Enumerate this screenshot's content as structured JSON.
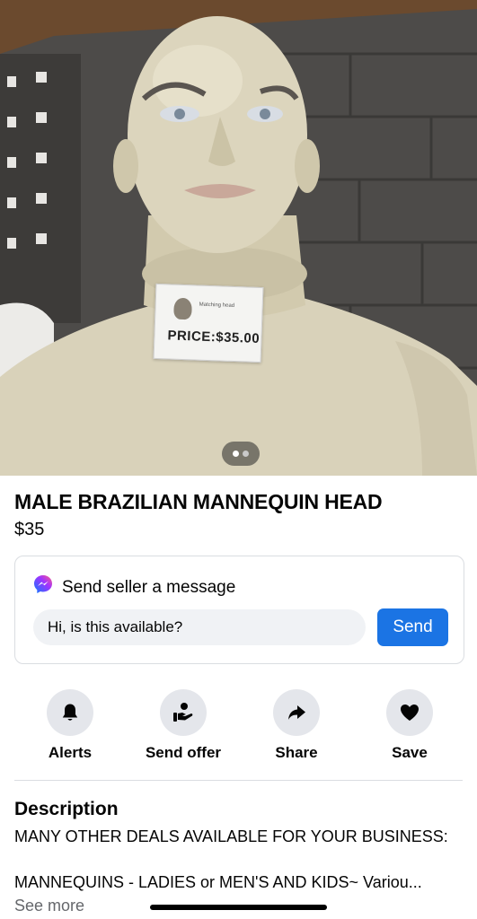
{
  "photo": {
    "tag_small_text": "Matching head",
    "tag_price_text": "PRICE:$35.00",
    "image_count": 2,
    "active_index": 0
  },
  "listing": {
    "title": "MALE BRAZILIAN MANNEQUIN HEAD",
    "price": "$35"
  },
  "message": {
    "heading": "Send seller a message",
    "input_value": "Hi, is this available?",
    "send_label": "Send"
  },
  "actions": {
    "alerts": "Alerts",
    "send_offer": "Send offer",
    "share": "Share",
    "save": "Save"
  },
  "description": {
    "heading": "Description",
    "line1": "MANY OTHER DEALS AVAILABLE FOR YOUR BUSINESS:",
    "line2": "MANNEQUINS - LADIES or MEN'S AND KIDS~ Variou...",
    "see_more": "See more"
  },
  "colors": {
    "accent": "#1b74e4",
    "secondary_text": "#65676b",
    "chip_bg": "#e4e6eb"
  }
}
